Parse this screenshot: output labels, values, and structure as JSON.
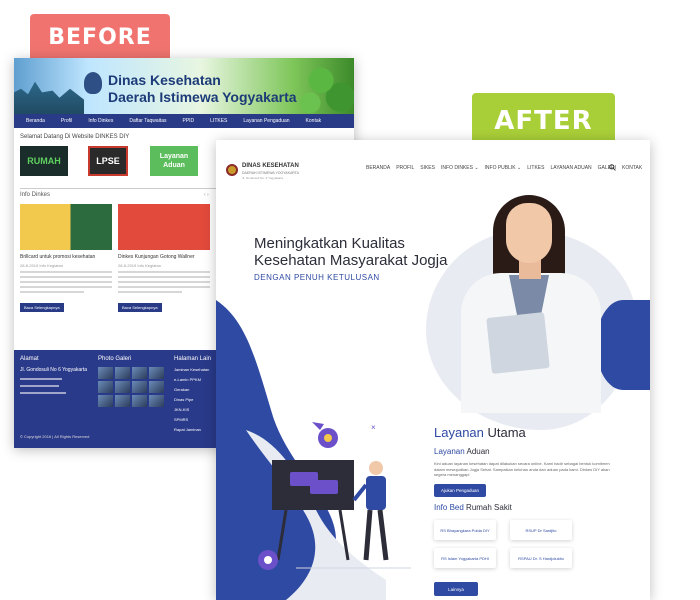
{
  "labels": {
    "before": "BEFORE",
    "after": "AFTER"
  },
  "before": {
    "banner_line1": "Dinas Kesehatan",
    "banner_line2": "Daerah Istimewa Yogyakarta",
    "nav": [
      "Beranda",
      "Profil",
      "Info Dinkes",
      "Daftar Taqwaitas",
      "PPID",
      "LITKES",
      "Layanan Pengaduan",
      "Kontak"
    ],
    "welcome": "Selamat Datang Di Website DINKES DIY",
    "tiles": [
      "RUMAH",
      "LPSE",
      "Layanan Aduan"
    ],
    "info_title": "Info Dinkes",
    "cards": [
      {
        "title": "Brillcard untuk promosi kesehatan",
        "meta": "28-8-2019  Info Kegiatan",
        "button": "Baca Selengkapnya"
      },
      {
        "title": "Dinkes Kunjungan Gotong Wallner",
        "meta": "28-8-2019  Info Kegiatan",
        "button": "Baca Selengkapnya"
      }
    ],
    "footer": {
      "col1_title": "Alamat",
      "col2_title": "Photo Galeri",
      "col3_title": "Halaman Lain",
      "col1_address": "Jl. Gondosuli No 6 Yogyakarta",
      "col3_items": [
        "Jaminan Kesehatan",
        "e-Lamin PPKM",
        "Gerakan",
        "Dinas Pipe",
        "JKN-KIS",
        "SPMRS",
        "Rapat Jaminan"
      ],
      "copyright": "© Copyright 2016 | All Rights Reserved"
    }
  },
  "after": {
    "brand_line1": "DINAS KESEHATAN",
    "brand_line2": "DAERAH ISTIMEWA YOGYAKARTA",
    "brand_line3": "Jl. Gondosuli No. 6 Yogyakarta",
    "nav": [
      "BERANDA",
      "PROFIL",
      "SIKES",
      "INFO DINKES ⌄",
      "INFO PUBLIK ⌄",
      "LITKES",
      "LAYANAN ADUAN",
      "GALERI",
      "KONTAK"
    ],
    "search_icon": "search-icon",
    "headline_line1": "Meningkatkan Kualitas",
    "headline_line2": "Kesehatan Masyarakat Jogja",
    "subheadline": "DENGAN PENUH KETULUSAN",
    "layanan_utama_a": "Layanan",
    "layanan_utama_b": " Utama",
    "layanan_aduan_a": "Layanan",
    "layanan_aduan_b": " Aduan",
    "aduan_desc": "Kini aduan layanan kesehatan dapat dilakukan secara online. Kami hadir sebagai bentuk komitmen dalam mewujudkan Jogja Sehat. Sampaikan keluhan anda dan aduan pada kami. Dinkes DIY akan segera menanggapi",
    "aduan_button": "Ajukan Pengaduan",
    "bed_a": "Info Bed",
    "bed_b": " Rumah Sakit",
    "hospitals": [
      "RS Bhayangkara Polda DIY",
      "RSUP Dr Sardjito",
      "RS Islam Yogyakarta PDHI",
      "RSPAU Dr. S Hardjolukito"
    ],
    "more_button": "Lainnya"
  },
  "colors": {
    "before_label": "#f0736f",
    "after_label": "#a9cf38",
    "primary_blue": "#2f4aa3",
    "before_nav": "#293a87"
  }
}
